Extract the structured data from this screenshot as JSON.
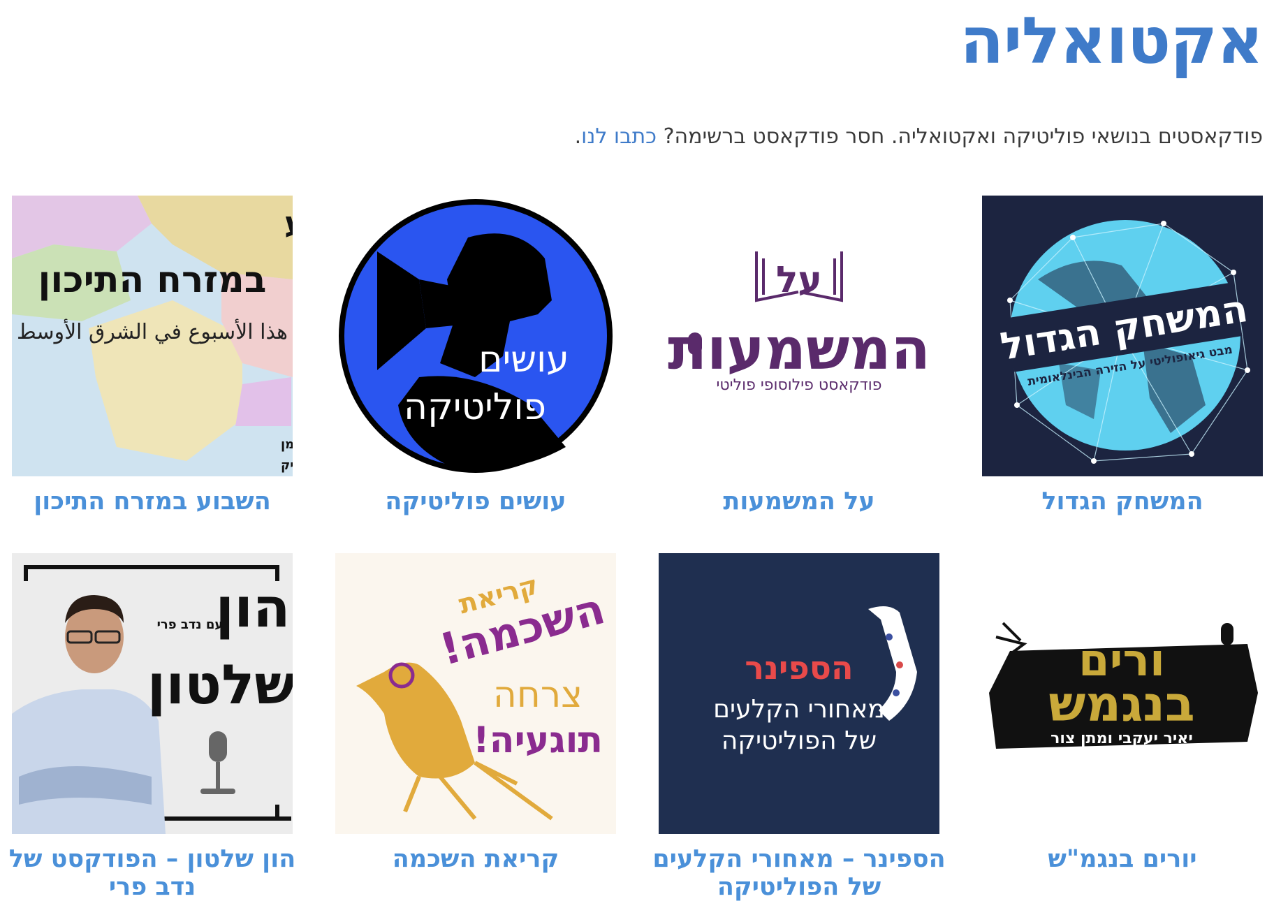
{
  "page": {
    "title": "אקטואליה",
    "intro_text": "פודקאסטים בנושאי פוליטיקה ואקטואליה. חסר פודקאסט ברשימה?",
    "intro_link": "כתבו לנו",
    "intro_end": "."
  },
  "colors": {
    "accent": "#3f7bc9",
    "card_title": "#4a90d9",
    "text": "#3a3a3a"
  },
  "podcasts": [
    {
      "title": "המשחק הגדול",
      "cover": {
        "line1": "המשחק הגדול",
        "line2": "מבט גיאופוליטי על הזירה הבינלאומית"
      }
    },
    {
      "title": "על המשמעות",
      "cover": {
        "line1": "על",
        "line2": "המשמעות",
        "line3": "פודקאסט פילוסופי פוליטי"
      }
    },
    {
      "title": "עושים פוליטיקה",
      "cover": {
        "line1": "עושים",
        "line2": "פוליטיקה"
      }
    },
    {
      "title": "השבוע במזרח התיכון",
      "cover": {
        "line1": "השבוע",
        "line2": "במזרח התיכון",
        "line3": "هذا الأسبوع في الشرق الأوسط",
        "line4": "עם ד״ר ירון פרידמן",
        "line5": "עורך ומגיש ד״ר בוריס גורליק"
      }
    },
    {
      "title": "יורים בנגמ\"ש",
      "cover": {
        "line1": "ורים",
        "line2": "בנגמש",
        "line3": "יאיר יעקבי ומתן צור"
      }
    },
    {
      "title": "הספינר – מאחורי הקלעים של הפוליטיקה",
      "cover": {
        "line1": "הספינר",
        "line2": "מאחורי הקלעים",
        "line3": "של הפוליטיקה"
      }
    },
    {
      "title": "קריאת השכמה",
      "cover": {
        "line1": "קריאת",
        "line2": "השכמה!",
        "line3": "צרחה",
        "line4": "תוגעיה!"
      }
    },
    {
      "title": "הון שלטון – הפודקסט של נדב פרי",
      "cover": {
        "line1": "הון",
        "line2": "שלטון",
        "line3": "עם נדב פרי"
      }
    }
  ]
}
